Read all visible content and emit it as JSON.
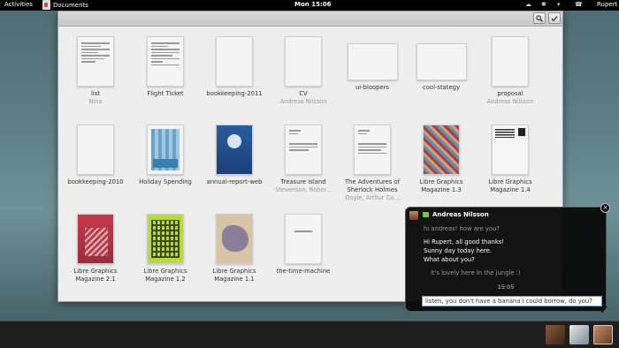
{
  "topbar": {
    "activities": "Activities",
    "app_name": "Documents",
    "clock": "Mon 15:06",
    "user": "Rupert",
    "indicators": [
      "☁",
      "✱",
      "▾",
      "☎"
    ]
  },
  "window": {
    "search_icon": "search-icon",
    "select_icon": "check-icon"
  },
  "documents": [
    {
      "name": "list",
      "author": "Nina",
      "thumb": "text"
    },
    {
      "name": "Flight Ticket",
      "author": "",
      "thumb": "text"
    },
    {
      "name": "bookkeeping-2011",
      "author": "",
      "thumb": "blank"
    },
    {
      "name": "CV",
      "author": "Andreas Nilsson",
      "thumb": "blank"
    },
    {
      "name": "ui-bloopers",
      "author": "",
      "thumb": "wide"
    },
    {
      "name": "cool-stategy",
      "author": "",
      "thumb": "wide"
    },
    {
      "name": "proposal",
      "author": "Andreas Nilsson",
      "thumb": "blank"
    },
    {
      "name": "bookkeeping-2010",
      "author": "",
      "thumb": "blank"
    },
    {
      "name": "Holiday Spending",
      "author": "",
      "thumb": "spreadsheet"
    },
    {
      "name": "annual-report-web",
      "author": "",
      "thumb": "blue"
    },
    {
      "name": "Treasure Island",
      "author": "Stevenson, Rober...",
      "thumb": "text"
    },
    {
      "name": "The Adventures of Sherlock Holmes",
      "author": "Doyle, Arthur Co...",
      "thumb": "text"
    },
    {
      "name": "Libre Graphics Magazine 1.3",
      "author": "",
      "thumb": "mag13"
    },
    {
      "name": "Libre Graphics Magazine 1.4",
      "author": "",
      "thumb": "mag14"
    },
    {
      "name": "Libre Graphics Magazine 2.1",
      "author": "",
      "thumb": "mag21"
    },
    {
      "name": "Libre Graphics Magazine 1.2",
      "author": "",
      "thumb": "mag12"
    },
    {
      "name": "Libre Graphics Magazine 1.1",
      "author": "",
      "thumb": "mag11"
    },
    {
      "name": "the-time-machine",
      "author": "",
      "thumb": "text"
    }
  ],
  "chat": {
    "from": "Andreas Nilsson",
    "messages": [
      {
        "text": "hi andreas! how are you?",
        "dim": true
      },
      {
        "text": "Hi Rupert, all good thanks!",
        "dim": false
      },
      {
        "text": "Sunny day today here.",
        "dim": false
      },
      {
        "text": "What about you?",
        "dim": false
      },
      {
        "text": "it's lovely here in the jungle :)",
        "dim": true
      }
    ],
    "time": "15:05",
    "reply_value": "listen, you don't have a banana i could borrow, do you?",
    "close_icon": "close-icon"
  },
  "tray": {
    "avatars": [
      "avatar-1",
      "avatar-2",
      "avatar-3"
    ]
  }
}
